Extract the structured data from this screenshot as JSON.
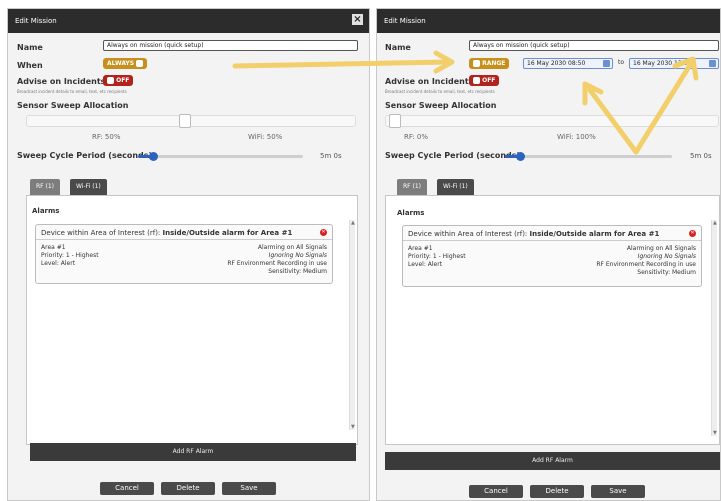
{
  "colors": {
    "arrow": "#f2cf6a",
    "titlebar": "#2c2c2c",
    "accent": "#c7901c",
    "off": "#b2231e",
    "progress": "#2d62c0"
  },
  "left": {
    "title": "Edit Mission",
    "close_icon": "×",
    "name_label": "Name",
    "name_value": "Always on mission (quick setup)",
    "when_label": "When",
    "when_toggle": "ALWAYS",
    "advise_label": "Advise on Incidents",
    "advise_toggle": "OFF",
    "advise_sub": "Broadcast incident details to email, text, etc recipients",
    "sweep_label": "Sensor Sweep Allocation",
    "rf_text": "RF: 50%",
    "wifi_text": "WiFi: 50%",
    "cycle_label": "Sweep Cycle Period (seconds)",
    "cycle_value": "5m 0s",
    "cycle_progress": 0.09,
    "tabs": [
      "RF (1)",
      "Wi-Fi (1)"
    ],
    "alarms_title": "Alarms",
    "alarm_header": "Device within Area of Interest (rf): ",
    "alarm_header_bold": "Inside/Outside alarm for Area #1",
    "alarm_left": [
      "Area #1",
      "Priority: 1 - Highest",
      "Level: Alert"
    ],
    "alarm_right": [
      "Alarming on All Signals",
      "Ignoring No Signals",
      "RF Environment Recording in use",
      "Sensitivity: Medium"
    ],
    "add_alarm": "Add RF Alarm",
    "buttons": [
      "Cancel",
      "Delete",
      "Save"
    ]
  },
  "right": {
    "title": "Edit Mission",
    "name_label": "Name",
    "name_value": "Always on mission (quick setup)",
    "when_toggle": "RANGE",
    "date_from": "16 May 2030 08:50",
    "to_label": "to",
    "date_to": "16 May 2030 13:04",
    "advise_label": "Advise on Incidents",
    "advise_toggle": "OFF",
    "advise_sub": "Broadcast incident details to email, text, etc recipients",
    "sweep_label": "Sensor Sweep Allocation",
    "rf_text": "RF: 0%",
    "wifi_text": "WiFi: 100%",
    "cycle_label": "Sweep Cycle Period (seconds)",
    "cycle_value": "5m 0s",
    "cycle_progress": 0.09,
    "tabs": [
      "RF (1)",
      "Wi-Fi (1)"
    ],
    "alarms_title": "Alarms",
    "alarm_header": "Device within Area of Interest (rf): ",
    "alarm_header_bold": "Inside/Outside alarm for Area #1",
    "alarm_left": [
      "Area #1",
      "Priority: 1 - Highest",
      "Level: Alert"
    ],
    "alarm_right": [
      "Alarming on All Signals",
      "Ignoring No Signals",
      "RF Environment Recording in use",
      "Sensitivity: Medium"
    ],
    "add_alarm": "Add RF Alarm",
    "buttons": [
      "Cancel",
      "Delete",
      "Save"
    ]
  }
}
